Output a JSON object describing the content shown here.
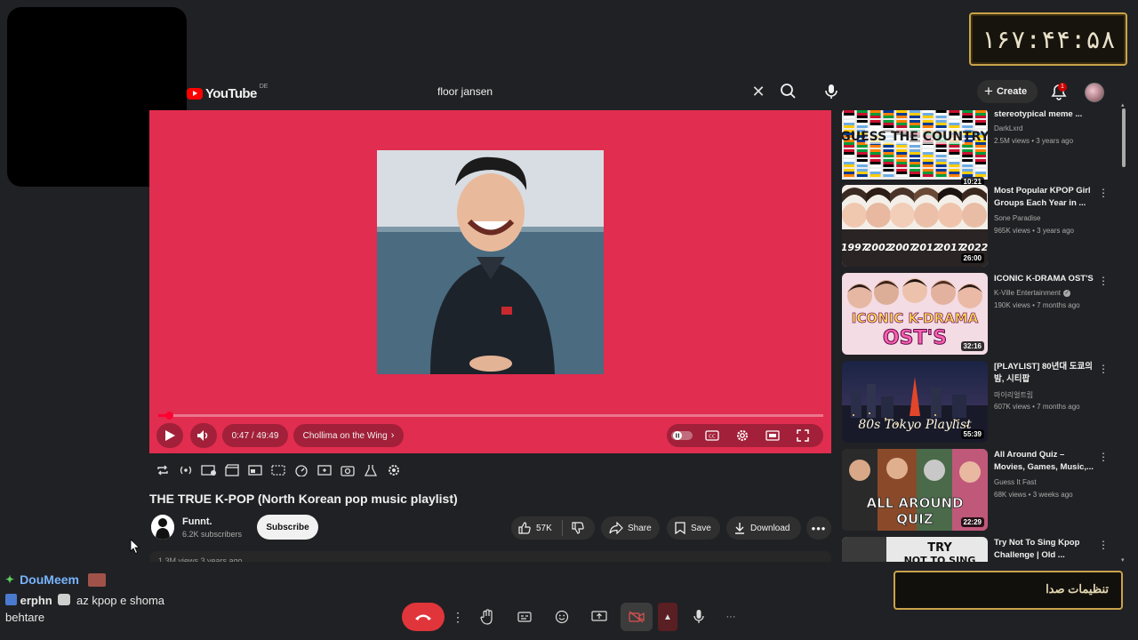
{
  "overlay": {
    "timer_text": "۱۶۷:۴۴:۵۸",
    "sound_settings_label": "تنظیمات صدا"
  },
  "header": {
    "logo_text": "YouTube",
    "region": "DE",
    "search_value": "floor jansen",
    "create_label": "Create",
    "notification_count": "1"
  },
  "player": {
    "time_text": "0:47 / 49:49",
    "chapter_label": "Chollima on the Wing",
    "progress_fraction": 0.016
  },
  "video": {
    "title": "THE TRUE K-POP (North Korean pop music playlist)",
    "channel_name": "Funnt.",
    "channel_subs": "6.2K subscribers",
    "subscribe_label": "Subscribe",
    "likes": "57K",
    "share_label": "Share",
    "save_label": "Save",
    "download_label": "Download",
    "description_peek": "1.3M views  3 years ago"
  },
  "recommendations": [
    {
      "title": "stereotypical meme ...",
      "channel": "DarkLxrd",
      "meta": "2.5M views • 3 years ago",
      "duration": "10:21",
      "thumb_text": "GUESS THE COUNTRY"
    },
    {
      "title": "Most Popular KPOP Girl Groups Each Year in ...",
      "channel": "Sone Paradise",
      "meta": "965K views • 3 years ago",
      "duration": "26:00",
      "years": [
        "1997",
        "2002",
        "2007",
        "2012",
        "2017",
        "2022"
      ]
    },
    {
      "title": "ICONIC K-DRAMA OST'S",
      "channel": "K-Ville Entertainment",
      "meta": "190K views • 7 months ago",
      "duration": "32:16",
      "thumb_text_1": "ICONIC K-DRAMA",
      "thumb_text_2": "OST'S",
      "verified": true
    },
    {
      "title": "[PLAYLIST] 80년대 도쿄의 밤, 시티팝",
      "channel": "마이리얼트립",
      "meta": "607K views • 7 months ago",
      "duration": "55:39",
      "thumb_text": "80s Tokyo Playlist"
    },
    {
      "title": "All Around Quiz – Movies, Games, Music,...",
      "channel": "Guess It Fast",
      "meta": "68K views • 3 weeks ago",
      "duration": "22:29",
      "thumb_text_1": "ALL AROUND",
      "thumb_text_2": "QUIZ"
    },
    {
      "title": "Try Not To Sing Kpop Challenge | Old ...",
      "channel": "",
      "meta": "",
      "duration": "",
      "thumb_text_1": "TRY",
      "thumb_text_2": "NOT TO SING"
    }
  ],
  "chat": [
    {
      "user": "DouMeem"
    },
    {
      "user": "erphn",
      "text": "az kpop e shoma behtare"
    }
  ],
  "colors": {
    "player_bg": "#e12d4f",
    "progress": "#ff0033",
    "accent_gold": "#c9a34a",
    "end_call": "#e0353b"
  }
}
